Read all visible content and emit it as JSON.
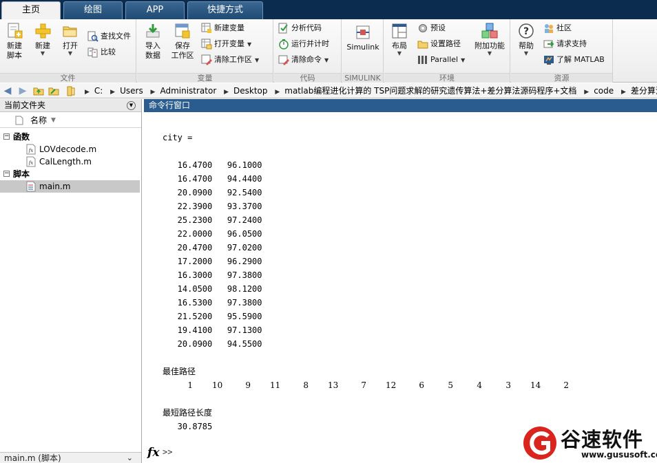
{
  "tabs": [
    {
      "label": "主页",
      "active": true
    },
    {
      "label": "绘图",
      "active": false
    },
    {
      "label": "APP",
      "active": false
    },
    {
      "label": "快捷方式",
      "active": false
    }
  ],
  "ribbon": {
    "groups": {
      "file": "文件",
      "variable": "变量",
      "code": "代码",
      "simulink": "SIMULINK",
      "environment": "环境",
      "resources": "资源"
    },
    "new_script": "新建\n脚本",
    "new_script_line1": "新建",
    "new_script_line2": "脚本",
    "new": "新建",
    "open": "打开",
    "find_files": "查找文件",
    "compare": "比较",
    "import_line1": "导入",
    "import_line2": "数据",
    "save_line1": "保存",
    "save_line2": "工作区",
    "new_variable": "新建变量",
    "open_variable": "打开变量",
    "clear_workspace": "清除工作区",
    "analyze_code": "分析代码",
    "run_and_time": "运行并计时",
    "clear_commands": "清除命令",
    "simulink": "Simulink",
    "layout": "布局",
    "preferences": "预设",
    "set_path": "设置路径",
    "parallel": "Parallel",
    "addons": "附加功能",
    "help": "帮助",
    "community": "社区",
    "request_support": "请求支持",
    "learn_matlab": "了解 MATLAB"
  },
  "address": {
    "path": [
      "C:",
      "Users",
      "Administrator",
      "Desktop",
      "matlab编程进化计算的 TSP问题求解的研究遗传算法+差分算法源码程序+文档",
      "code",
      "差分算法"
    ]
  },
  "current_folder": {
    "title": "当前文件夹",
    "column_name": "名称",
    "sections": [
      {
        "label": "函数",
        "files": [
          "LOVdecode.m",
          "CalLength.m"
        ]
      },
      {
        "label": "脚本",
        "files": [
          "main.m"
        ]
      }
    ],
    "footer": "main.m  (脚本)"
  },
  "command_window": {
    "title": "命令行窗口",
    "var_line": "city =",
    "city": [
      [
        "16.4700",
        "96.1000"
      ],
      [
        "16.4700",
        "94.4400"
      ],
      [
        "20.0900",
        "92.5400"
      ],
      [
        "22.3900",
        "93.3700"
      ],
      [
        "25.2300",
        "97.2400"
      ],
      [
        "22.0000",
        "96.0500"
      ],
      [
        "20.4700",
        "97.0200"
      ],
      [
        "17.2000",
        "96.2900"
      ],
      [
        "16.3000",
        "97.3800"
      ],
      [
        "14.0500",
        "98.1200"
      ],
      [
        "16.5300",
        "97.3800"
      ],
      [
        "21.5200",
        "95.5900"
      ],
      [
        "19.4100",
        "97.1300"
      ],
      [
        "20.0900",
        "94.5500"
      ]
    ],
    "best_route_label": "最佳路径",
    "best_route": [
      1,
      10,
      9,
      11,
      8,
      13,
      7,
      12,
      6,
      5,
      4,
      3,
      14,
      2
    ],
    "shortest_label": "最短路径长度",
    "shortest_value": "30.8785",
    "prompt": ">>",
    "fx": "fx"
  },
  "watermark": {
    "title": "谷速软件",
    "url": "www.gususoft.com"
  }
}
